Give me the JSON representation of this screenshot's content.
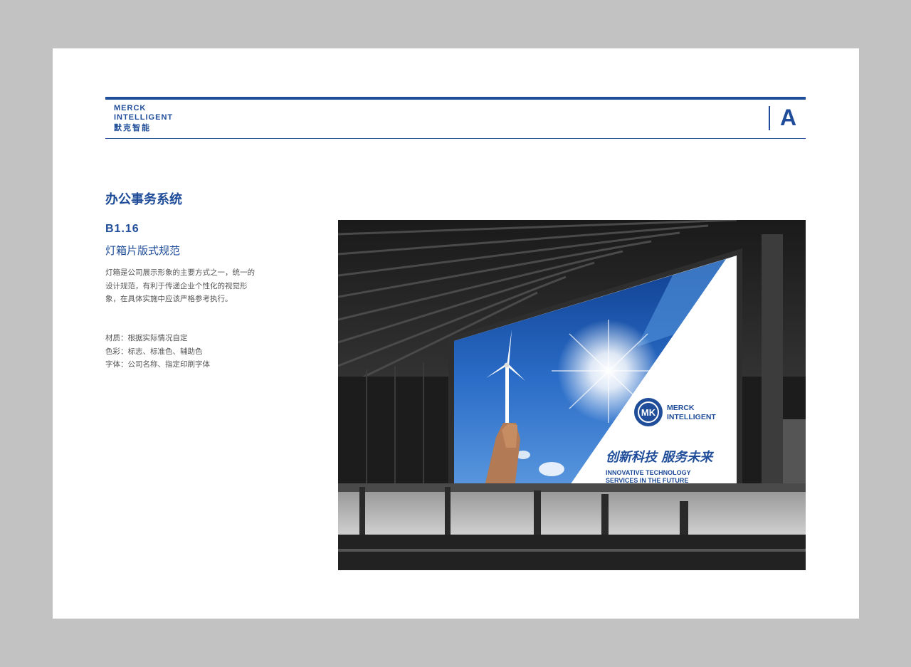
{
  "header": {
    "brand_en_1": "MERCK",
    "brand_en_2": "INTELLIGENT",
    "brand_cn": "默克智能",
    "section_letter": "A"
  },
  "content": {
    "section_title": "办公事务系统",
    "code": "B1.16",
    "subtitle": "灯箱片版式规范",
    "description": "灯箱是公司展示形象的主要方式之一，统一的设计规范，有利于传递企业个性化的视觉形象，在具体实施中应该严格参考执行。",
    "specs": [
      "材质：根据实际情况自定",
      "色彩：标志、标准色、辅助色",
      "字体：公司名称、指定印刷字体"
    ]
  },
  "lightbox": {
    "logo_mark": "MK",
    "logo_line1": "MERCK",
    "logo_line2": "INTELLIGENT",
    "slogan_cn": "创新科技 服务未来",
    "slogan_en_1": "INNOVATIVE TECHNOLOGY",
    "slogan_en_2": "SERVICES IN THE FUTURE"
  },
  "colors": {
    "brand_blue": "#1f4d9a",
    "page_bg": "#c2c2c2",
    "sheet_bg": "#ffffff"
  },
  "icons": [
    "wind-turbine-icon",
    "sun-icon",
    "mk-logo-icon"
  ]
}
